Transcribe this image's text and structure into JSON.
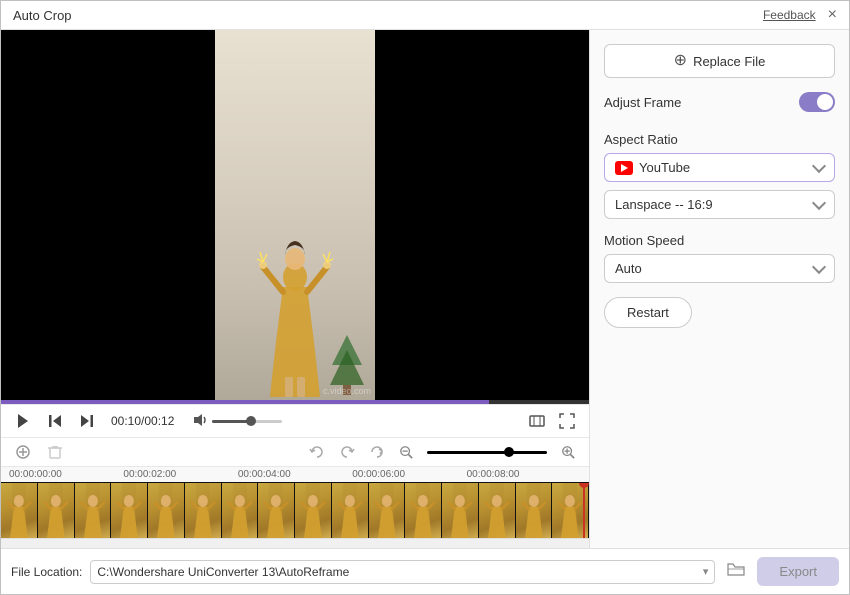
{
  "window": {
    "title": "Auto Crop",
    "feedback_label": "Feedback",
    "close_label": "×"
  },
  "controls": {
    "time_current": "00:10",
    "time_total": "00:12",
    "time_display": "00:10/00:12"
  },
  "right_panel": {
    "replace_file_label": "Replace File",
    "adjust_frame_label": "Adjust Frame",
    "adjust_frame_on": true,
    "aspect_ratio_label": "Aspect Ratio",
    "aspect_ratio_value": "YouTube",
    "aspect_ratio_sub_value": "Lanspace -- 16:9",
    "motion_speed_label": "Motion Speed",
    "motion_speed_value": "Auto",
    "restart_label": "Restart"
  },
  "timeline": {
    "times": [
      "00:00:00:00",
      "00:00:02:00",
      "00:00:04:00",
      "00:00:06:00",
      "00:00:08:00"
    ]
  },
  "bottom": {
    "file_location_label": "File Location:",
    "file_path": "C:\\Wondershare UniConverter 13\\AutoReframe",
    "export_label": "Export"
  },
  "icons": {
    "play": "▶",
    "step_back": "⏮",
    "step_forward": "⏭",
    "volume": "🔊",
    "expand": "⛶",
    "fullscreen": "⤢",
    "undo": "↩",
    "redo": "↪",
    "rotate": "↻",
    "zoom_out": "−",
    "zoom_in": "+",
    "plus": "⊕",
    "add": "✚",
    "trash": "🗑",
    "folder": "📁",
    "chevron_down": "▾"
  }
}
